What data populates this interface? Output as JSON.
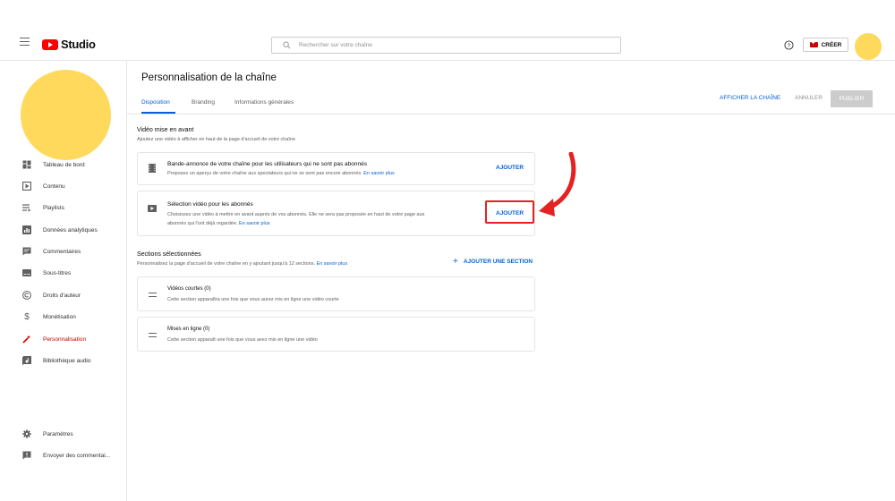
{
  "header": {
    "app_name": "Studio",
    "search_placeholder": "Rechercher sur votre chaîne",
    "create_label": "CRÉER"
  },
  "sidebar": {
    "items": [
      {
        "label": "Tableau de bord",
        "icon": "dashboard-icon"
      },
      {
        "label": "Contenu",
        "icon": "content-icon"
      },
      {
        "label": "Playlists",
        "icon": "playlists-icon"
      },
      {
        "label": "Données analytiques",
        "icon": "analytics-icon"
      },
      {
        "label": "Commentaires",
        "icon": "comments-icon"
      },
      {
        "label": "Sous-titres",
        "icon": "subtitles-icon"
      },
      {
        "label": "Droits d'auteur",
        "icon": "copyright-icon"
      },
      {
        "label": "Monétisation",
        "icon": "dollar-icon"
      },
      {
        "label": "Personnalisation",
        "icon": "magic-wand-icon",
        "active": true
      },
      {
        "label": "Bibliothèque audio",
        "icon": "audio-library-icon"
      }
    ],
    "bottom_items": [
      {
        "label": "Paramètres",
        "icon": "gear-icon"
      },
      {
        "label": "Envoyer des commentai...",
        "icon": "feedback-icon"
      }
    ]
  },
  "main": {
    "title": "Personnalisation de la chaîne",
    "tabs": [
      {
        "label": "Disposition",
        "active": true
      },
      {
        "label": "Branding"
      },
      {
        "label": "Informations générales"
      }
    ],
    "actions": {
      "view_channel": "AFFICHER LA CHAÎNE",
      "cancel": "ANNULER",
      "publish": "PUBLIER"
    },
    "featured": {
      "title": "Vidéo mise en avant",
      "description": "Ajoutez une vidéo à afficher en haut de la page d'accueil de votre chaîne",
      "cards": [
        {
          "title": "Bande-annonce de votre chaîne pour les utilisateurs qui ne sont pas abonnés",
          "description": "Proposez un aperçu de votre chaîne aux spectateurs qui ne se sont pas encore abonnés.",
          "link": "En savoir plus",
          "button": "AJOUTER"
        },
        {
          "title": "Sélection vidéo pour les abonnés",
          "description_line1": "Choisissez une vidéo à mettre en avant auprès de vos abonnés. Elle ne sera pas proposée en haut de votre page aux",
          "description_line2": "abonnés qui l'ont déjà regardée.",
          "link": "En savoir plus",
          "button": "AJOUTER"
        }
      ]
    },
    "sections": {
      "title": "Sections sélectionnées",
      "description": "Personnalisez la page d'accueil de votre chaîne en y ajoutant jusqu'à 12 sections.",
      "link": "En savoir plus",
      "add_button": "AJOUTER UNE SECTION",
      "items": [
        {
          "title": "Vidéos courtes (0)",
          "description": "Cette section apparaîtra une fois que vous aurez mis en ligne une vidéo courte"
        },
        {
          "title": "Mises en ligne (0)",
          "description": "Cette section apparaît une fois que vous avez mis en ligne une vidéo"
        }
      ]
    }
  },
  "colors": {
    "accent": "#065fd4",
    "brand_red": "#ff0000",
    "highlight_red": "#e52121",
    "avatar": "#ffd95c"
  }
}
